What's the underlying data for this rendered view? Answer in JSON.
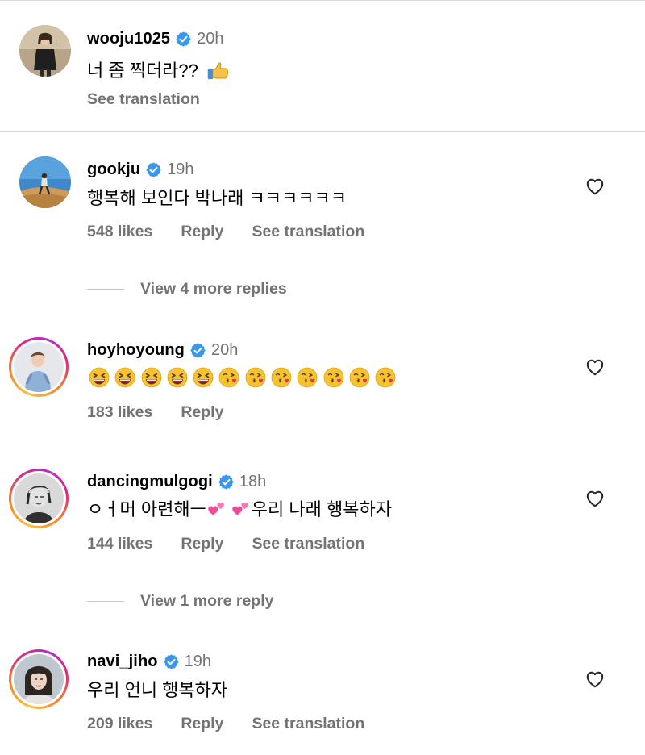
{
  "comments": [
    {
      "username": "wooju1025",
      "time": "20h",
      "text": "너 좀 찍더라??",
      "see_translation": "See translation"
    },
    {
      "username": "gookju",
      "time": "19h",
      "text": "행복해 보인다 박나래 ㅋㅋㅋㅋㅋㅋ",
      "likes": "548 likes",
      "reply": "Reply",
      "see_translation": "See translation",
      "view_replies": "View 4 more replies"
    },
    {
      "username": "hoyhoyoung",
      "time": "20h",
      "likes": "183 likes",
      "reply": "Reply"
    },
    {
      "username": "dancingmulgogi",
      "time": "18h",
      "text_part1": "ㅇㅓ머 아련해ㅡ",
      "text_part2": "우리 나래 행복하자",
      "likes": "144 likes",
      "reply": "Reply",
      "see_translation": "See translation",
      "view_replies": "View 1 more reply"
    },
    {
      "username": "navi_jiho",
      "time": "19h",
      "text": "우리 언니 행복하자",
      "likes": "209 likes",
      "reply": "Reply",
      "see_translation": "See translation"
    }
  ],
  "icons": {
    "verified": "verified-badge-icon",
    "heart": "heart-outline-icon",
    "thumbs_up": "thumbs-up-emoji",
    "laughing": "grinning-squinting-face-emoji",
    "kiss": "face-blowing-kiss-emoji",
    "hearts": "two-hearts-emoji"
  },
  "colors": {
    "verified_blue": "#3897f0",
    "secondary_text": "#737373",
    "divider": "#dbdbdb"
  }
}
